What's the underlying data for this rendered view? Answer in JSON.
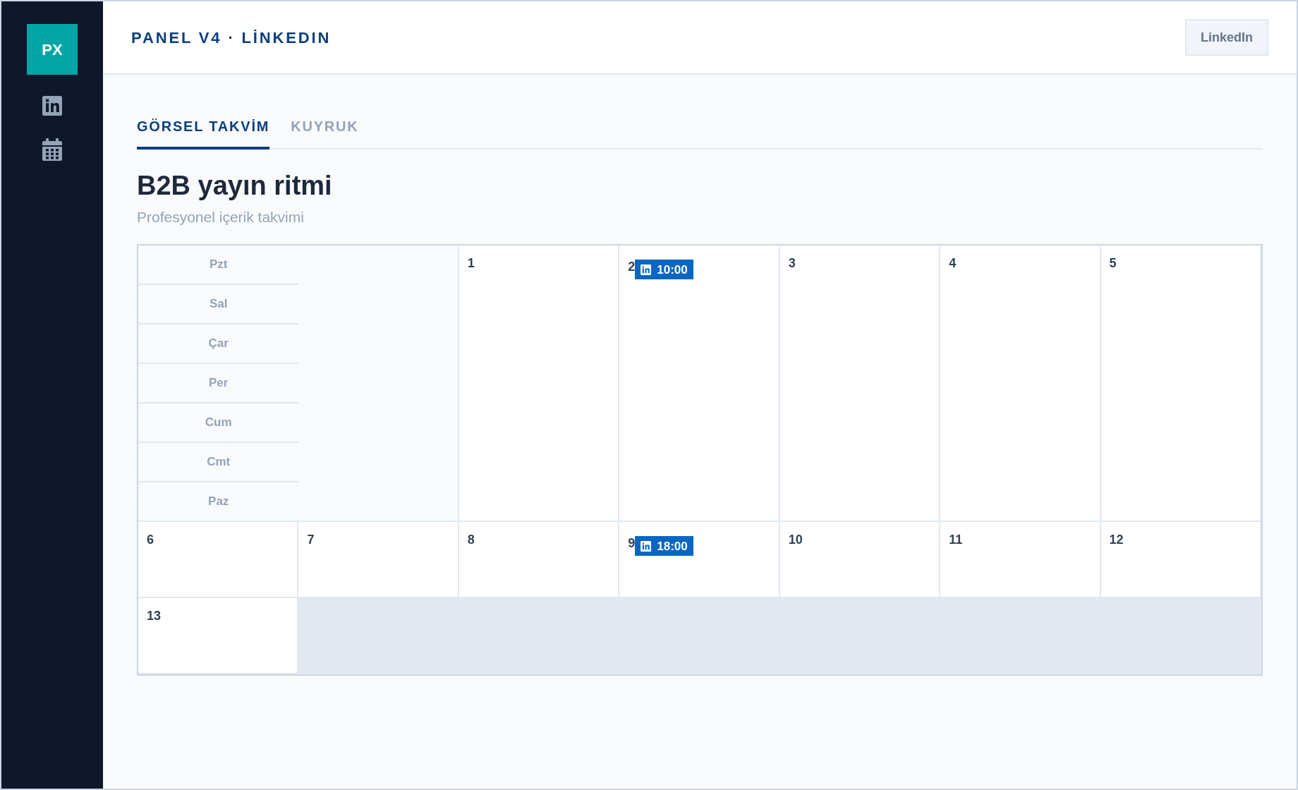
{
  "sidebar": {
    "logo": "PX"
  },
  "header": {
    "title": "PANEL V4 · LİNKEDIN",
    "button": "LinkedIn"
  },
  "tabs": [
    {
      "label": "GÖRSEL TAKVİM",
      "selected": true
    },
    {
      "label": "KUYRUK",
      "selected": false
    }
  ],
  "page": {
    "title": "B2B yayın ritmi",
    "subtitle": "Profesyonel içerik takvimi"
  },
  "calendar": {
    "weekdays": [
      "Pzt",
      "Sal",
      "Çar",
      "Per",
      "Cum",
      "Cmt",
      "Paz"
    ],
    "days": [
      {
        "day": "1"
      },
      {
        "day": "2",
        "events": [
          {
            "kind": "linkedin",
            "time": "10:00"
          }
        ]
      },
      {
        "day": "3"
      },
      {
        "day": "4"
      },
      {
        "day": "5"
      },
      {
        "day": "6"
      },
      {
        "day": "7"
      },
      {
        "day": "8"
      },
      {
        "day": "9",
        "events": [
          {
            "kind": "linkedin",
            "time": "18:00"
          }
        ]
      },
      {
        "day": "10"
      },
      {
        "day": "11"
      },
      {
        "day": "12"
      },
      {
        "day": "13"
      }
    ]
  }
}
